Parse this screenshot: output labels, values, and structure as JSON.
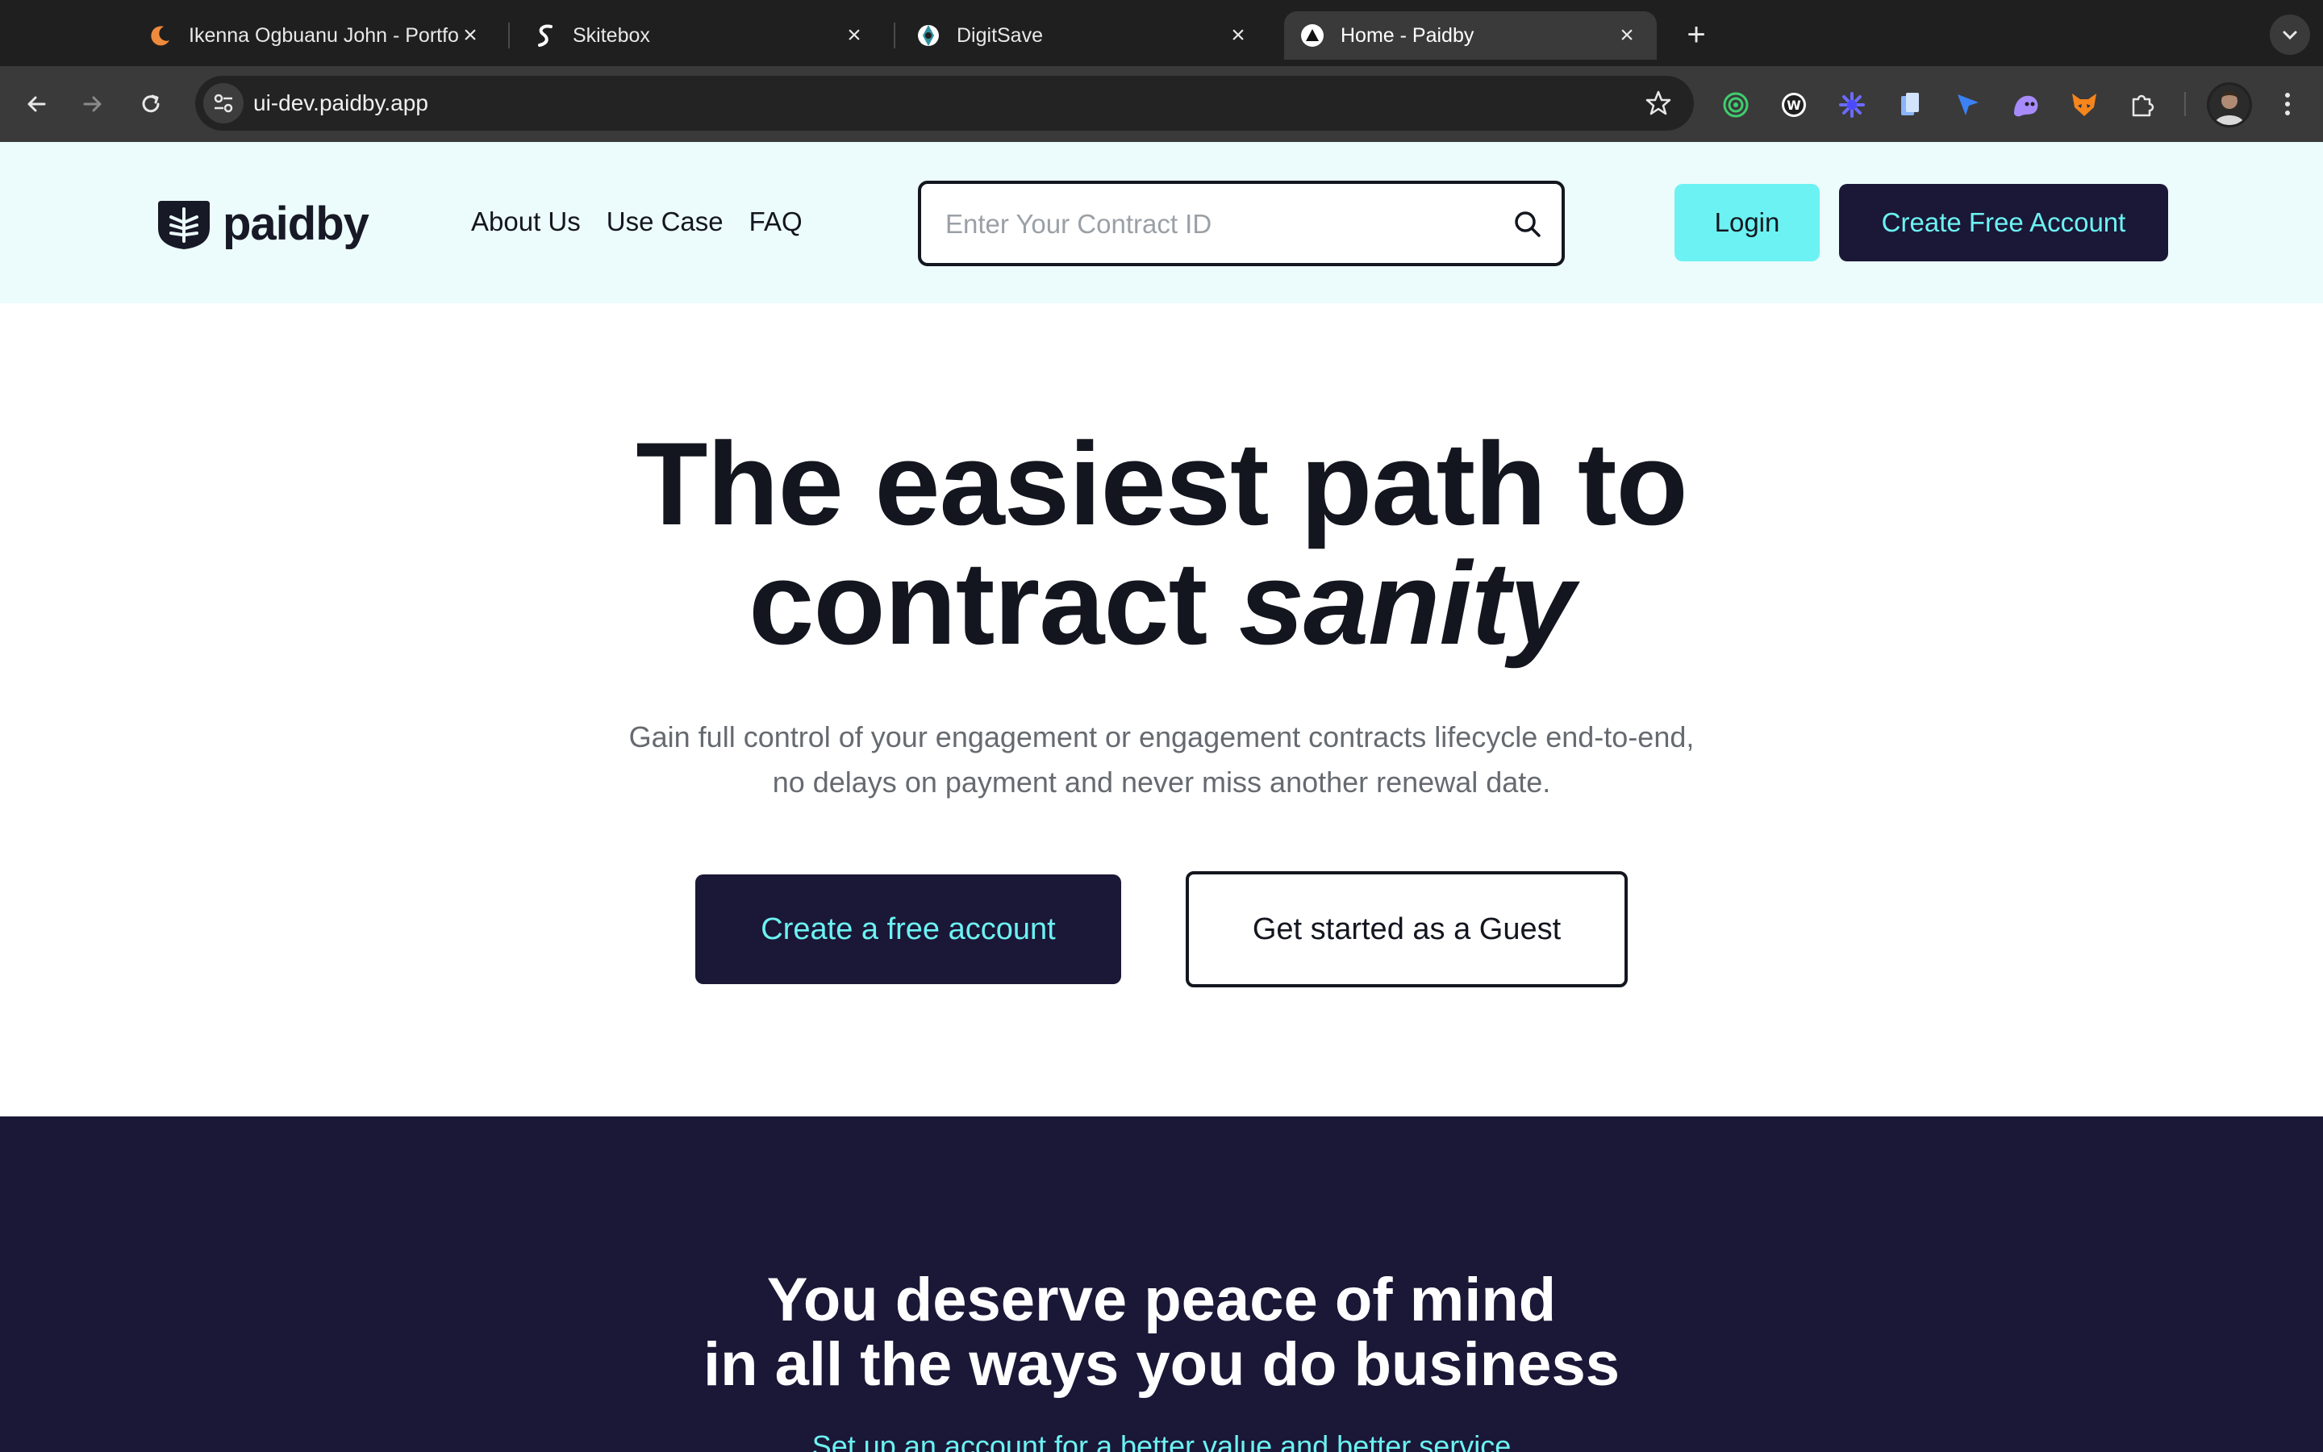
{
  "browser": {
    "tabs": [
      {
        "title": "Ikenna Ogbuanu John - Portfolio",
        "icon": "crescent-moon-icon",
        "active": false
      },
      {
        "title": "Skitebox",
        "icon": "skitebox-logo-icon",
        "active": false
      },
      {
        "title": "DigitSave",
        "icon": "digitsave-logo-icon",
        "active": false
      },
      {
        "title": "Home - Paidby",
        "icon": "triangle-logo-icon",
        "active": true
      }
    ],
    "address": "ui-dev.paidby.app",
    "extensions": [
      "green-ring-icon",
      "w-circle-icon",
      "blue-asterisk-icon",
      "blue-document-icon",
      "blue-arrow-icon",
      "purple-ghost-icon",
      "fox-icon",
      "puzzle-icon"
    ]
  },
  "header": {
    "logo_text": "paidby",
    "nav": [
      "About Us",
      "Use Case",
      "FAQ"
    ],
    "search_placeholder": "Enter Your Contract ID",
    "login_label": "Login",
    "create_account_label": "Create Free Account"
  },
  "hero": {
    "title_line1": "The easiest path to",
    "title_line2_plain": "contract ",
    "title_line2_italic": "sanity",
    "subtitle_line1": "Gain full control of your engagement or engagement contracts lifecycle end-to-end,",
    "subtitle_line2": "no delays on payment and never miss another renewal date.",
    "cta_primary": "Create a free account",
    "cta_secondary": "Get started as a Guest"
  },
  "section2": {
    "title_line1": "You deserve peace of mind",
    "title_line2": "in all the ways you do business",
    "subtitle": "Set up an account for a better value and better service"
  },
  "colors": {
    "navy": "#1b1737",
    "cyan": "#6cf2f2",
    "header_bg": "#ecfbfb",
    "text_dark": "#14161f",
    "text_muted": "#666a70"
  }
}
